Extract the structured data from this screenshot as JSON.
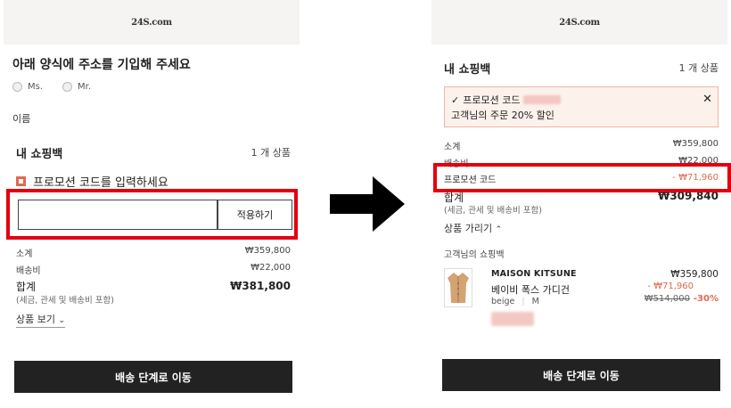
{
  "logo": "24S.com",
  "left": {
    "address_title": "아래 양식에 주소를 기입해 주세요",
    "title_options": [
      "Ms.",
      "Mr."
    ],
    "name_label": "이름",
    "cart_title": "내 쇼핑백",
    "cart_count": "1 개 상품",
    "promo_toggle_label": "프로모션 코드를 입력하세요",
    "promo_input_value": "",
    "apply_label": "적용하기",
    "subtotal_label": "소계",
    "subtotal_value": "₩359,800",
    "shipping_label": "배송비",
    "shipping_value": "₩22,000",
    "total_label": "합계",
    "total_value": "₩381,800",
    "tax_note": "(세금, 관세 및 배송비 포함)",
    "view_products": "상품 보기",
    "cta": "배송 단계로 이동"
  },
  "right": {
    "cart_title": "내 쇼핑백",
    "cart_count": "1 개 상품",
    "promo_applied_line1": "프로모션 코드",
    "promo_applied_line2": "고객님의 주문 20% 할인",
    "subtotal_label": "소계",
    "subtotal_value": "₩359,800",
    "shipping_label": "배송비",
    "shipping_value": "₩22,000",
    "promo_label": "프로모션 코드",
    "promo_value": "- ₩71,960",
    "total_label": "합계",
    "total_value": "₩309,840",
    "tax_note": "(세금, 관세 및 배송비 포함)",
    "hide_products": "상품 가리기",
    "section_title": "고객님의 쇼핑백",
    "product": {
      "brand": "MAISON KITSUNE",
      "name": "베이비 폭스 가디건",
      "color": "beige",
      "size": "M",
      "price": "₩359,800",
      "discount": "- ₩71,960",
      "original_price": "₩514,000",
      "discount_rate": "-30%"
    },
    "cta": "배송 단계로 이동"
  },
  "colors": {
    "accent": "#e0694f",
    "highlight": "#e3000f",
    "cta_bg": "#222222",
    "header_bg": "#f5f4f2"
  }
}
